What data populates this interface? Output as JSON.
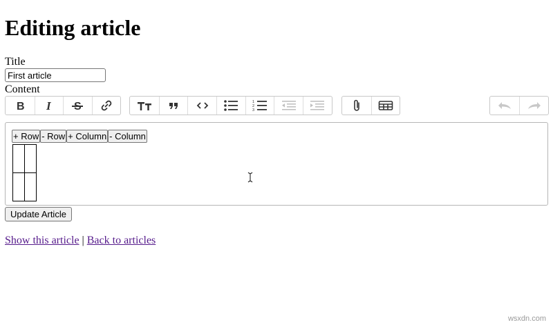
{
  "page": {
    "heading": "Editing article",
    "title_label": "Title",
    "title_value": "First article",
    "content_label": "Content",
    "update_button": "Update Article"
  },
  "toolbar": {
    "text_group": [
      {
        "name": "bold",
        "icon": "bold-icon",
        "enabled": true
      },
      {
        "name": "italic",
        "icon": "italic-icon",
        "enabled": true
      },
      {
        "name": "strikethrough",
        "icon": "strikethrough-icon",
        "enabled": true
      },
      {
        "name": "link",
        "icon": "link-icon",
        "enabled": true
      }
    ],
    "block_group": [
      {
        "name": "heading",
        "icon": "heading-icon",
        "enabled": true
      },
      {
        "name": "quote",
        "icon": "quote-icon",
        "enabled": true
      },
      {
        "name": "code",
        "icon": "code-icon",
        "enabled": true
      },
      {
        "name": "bullet-list",
        "icon": "bullet-list-icon",
        "enabled": true
      },
      {
        "name": "numbered-list",
        "icon": "numbered-list-icon",
        "enabled": true
      },
      {
        "name": "decrease-indent",
        "icon": "outdent-icon",
        "enabled": false
      },
      {
        "name": "increase-indent",
        "icon": "indent-icon",
        "enabled": false
      }
    ],
    "file_group": [
      {
        "name": "attach-files",
        "icon": "paperclip-icon",
        "enabled": true
      },
      {
        "name": "insert-table",
        "icon": "table-icon",
        "enabled": true
      }
    ],
    "history_group": [
      {
        "name": "undo",
        "icon": "undo-icon",
        "enabled": false
      },
      {
        "name": "redo",
        "icon": "redo-icon",
        "enabled": false
      }
    ]
  },
  "editor": {
    "table_controls": {
      "add_row": "+ Row",
      "remove_row": "- Row",
      "add_column": "+ Column",
      "remove_column": "- Column"
    },
    "table": {
      "rows": 2,
      "columns": 2
    }
  },
  "links": {
    "show": "Show this article",
    "separator": " | ",
    "back": "Back to articles"
  },
  "watermark": "wsxdn.com",
  "colors": {
    "link": "#1a0dab",
    "visited_link": "#551a8b",
    "toolbar_border": "#c8c8c8",
    "disabled_icon": "#c0c0c0"
  }
}
